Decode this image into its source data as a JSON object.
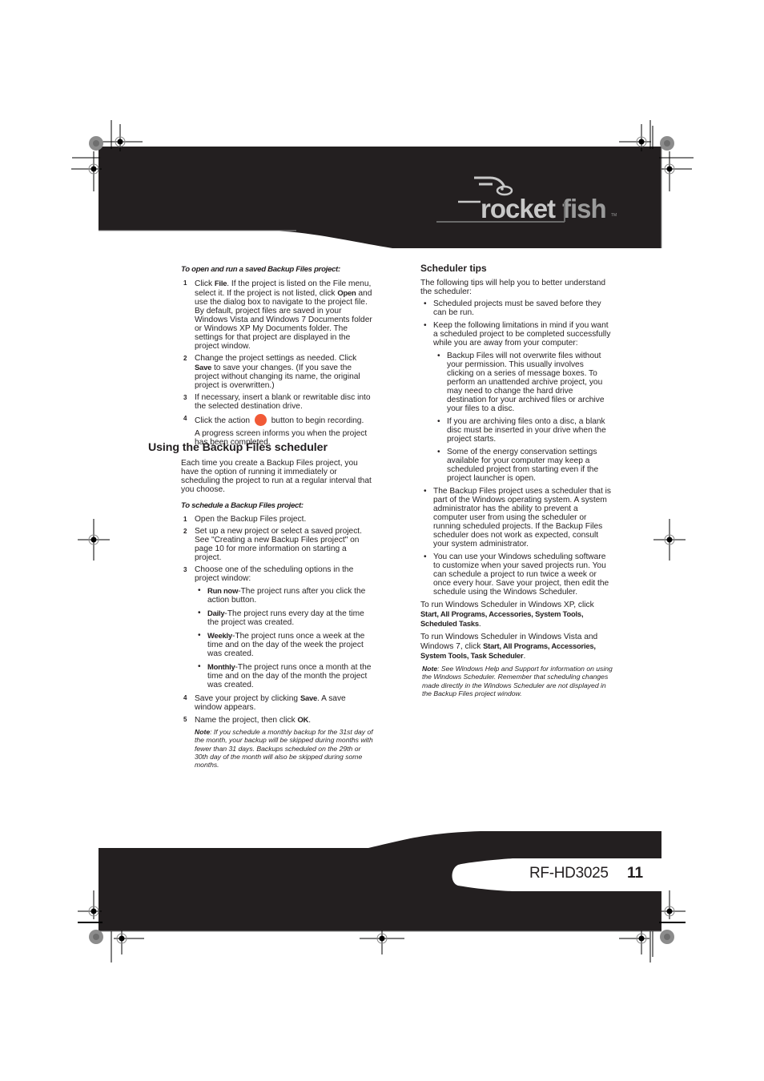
{
  "header": {
    "logo": {
      "brand_left": "rocket",
      "brand_right": "fish",
      "trademark": "TM"
    },
    "colors": {
      "banner": "#231f20",
      "logo": "#c8c8c8",
      "action_button": "#f15a37"
    }
  },
  "left_column": {
    "open_procedure": {
      "title": "To open and run a saved Backup Files project:",
      "steps": [
        {
          "num": "1",
          "parts": [
            "Click ",
            "File",
            ". If the project is listed on the File menu, select it. If the project is not listed, click ",
            "Open",
            " and use the dialog box to navigate to the project file. By default, project files are saved in your Windows Vista and Windows 7 Documents folder or Windows XP My Documents folder. The settings for that project are displayed in the project window."
          ]
        },
        {
          "num": "2",
          "parts": [
            "Change the project settings as needed. Click ",
            "Save",
            " to save your changes. (If you save the project without changing its name, the original project is overwritten.)"
          ]
        },
        {
          "num": "3",
          "text": "If necessary, insert a blank or rewritable disc into the selected destination drive."
        },
        {
          "num": "4",
          "text_before": "Click the action",
          "icon": "action-record-button-icon",
          "text_after": "button to begin recording.",
          "followup": "A progress screen informs you when the project has been completed."
        }
      ]
    },
    "scheduler_section": {
      "heading": "Using the Backup Files scheduler",
      "intro": "Each time you create a Backup Files project, you have the option of running it immediately or scheduling the project to run at a regular interval that you choose.",
      "procedure_title": "To schedule a Backup Files project:",
      "steps": [
        {
          "num": "1",
          "text": "Open the Backup Files project."
        },
        {
          "num": "2",
          "text": "Set up a new project or select a saved project. See \"Creating a new Backup Files project\" on page 10 for more information on starting a project."
        },
        {
          "num": "3",
          "text": "Choose one of the scheduling options in the project window:",
          "options": [
            {
              "label": "Run now",
              "desc": "-The project runs after you click the action button."
            },
            {
              "label": "Daily",
              "desc": "-The project runs every day at the time the project was created."
            },
            {
              "label": "Weekly",
              "desc": "-The project runs once a week at the time and on the day of the week the project was created."
            },
            {
              "label": "Monthly",
              "desc": "-The project runs once a month at the time and on the day of the month the project was created."
            }
          ]
        },
        {
          "num": "4",
          "parts": [
            "Save your project by clicking ",
            "Save",
            ". A save window appears."
          ]
        },
        {
          "num": "5",
          "parts": [
            "Name the project, then click ",
            "OK",
            "."
          ]
        }
      ],
      "note": {
        "label": "Note",
        "text": ": If you schedule a monthly backup for the 31st day of the month, your backup will be skipped during months with fewer than 31 days. Backups scheduled on the 29th or 30th day of the month will also be skipped during some months."
      }
    }
  },
  "right_column": {
    "heading": "Scheduler tips",
    "intro": "The following tips will help you to better understand the scheduler:",
    "tips": [
      {
        "text": "Scheduled projects must be saved before they can be run."
      },
      {
        "text": "Keep the following limitations in mind if you want a scheduled project to be completed successfully while you are away from your computer:",
        "subtips": [
          "Backup Files will not overwrite files without your permission. This usually involves clicking on a series of message boxes. To perform an unattended archive project, you may need to change the hard drive destination for your archived files or archive your files to a disc.",
          "If you are archiving files onto a disc, a blank disc must be inserted in your drive when the project starts.",
          "Some of the energy conservation settings available for your computer may keep a scheduled project from starting even if the project launcher is open."
        ]
      },
      {
        "text": "The Backup Files project uses a scheduler that is part of the Windows operating system. A system administrator has the ability to prevent a computer user from using the scheduler or running scheduled projects. If the Backup Files scheduler does not work as expected, consult your system administrator."
      },
      {
        "text": "You can use your Windows scheduling software to customize when your saved projects run. You can schedule a project to run twice a week or once every hour. Save your project, then edit the schedule using the Windows Scheduler."
      }
    ],
    "xp_instructions": {
      "text": "To run Windows Scheduler in Windows XP, click ",
      "path": "Start, All Programs, Accessories, System Tools, Scheduled Tasks",
      "end": "."
    },
    "vista_instructions": {
      "text": "To run Windows Scheduler in Windows Vista and Windows 7, click ",
      "path": "Start, All Programs, Accessories, System Tools, Task Scheduler",
      "end": "."
    },
    "note": {
      "label": "Note",
      "text": ": See Windows Help and Support for information on using the Windows Scheduler. Remember that scheduling changes made directly in the Windows Scheduler are not displayed in the Backup Files project window."
    }
  },
  "footer": {
    "model": "RF-HD3025",
    "page_number": "11"
  }
}
